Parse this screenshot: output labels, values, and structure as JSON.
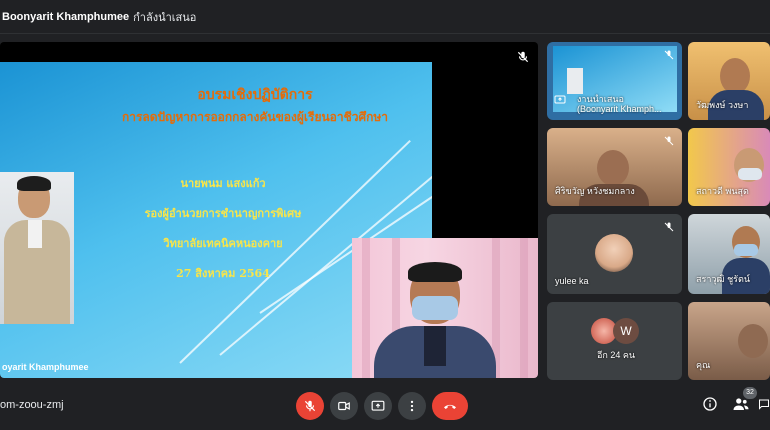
{
  "top_banner": {
    "presenter": "Boonyarit Khamphumee",
    "status": "กำลังนำเสนอ"
  },
  "slide": {
    "title_line1": "อบรมเชิงปฏิบัติการ",
    "title_line2": "การลดปัญหาการออกกลางคันของผู้เรียนอาชีวศึกษา",
    "speaker_name": "นายพนม แสงแก้ว",
    "speaker_role": "รองผู้อำนวยการชำนาญการพิเศษ",
    "institution": "วิทยาลัยเทคนิคหนองคาย",
    "date": "27 สิงหาคม 2564"
  },
  "stage": {
    "speaker_label": "oyarit Khamphumee"
  },
  "tiles": [
    {
      "name": "งานนำเสนอ\n(Boonyarit Khamph...",
      "muted": true
    },
    {
      "name": "วัฒพงษ์ วงษา",
      "muted": false
    },
    {
      "name": "ศิริขวัญ หวังชมกลาง",
      "muted": true
    },
    {
      "name": "สถาวดี พนสุด",
      "muted": false
    },
    {
      "name": "yulee ka",
      "muted": true
    },
    {
      "name": "สราวุฒิ ชูรัตน์",
      "muted": false
    },
    {
      "name": "อีก 24 คน",
      "muted": false,
      "avatar_letter": "W"
    },
    {
      "name": "คุณ",
      "muted": false
    }
  ],
  "bottom_bar": {
    "meeting_code": "om-zoou-zmj",
    "participant_count": "32"
  },
  "colors": {
    "background": "#202124",
    "tile": "#3c4043",
    "danger": "#ea4335",
    "slide_title": "#e46c0a",
    "slide_text": "#f8e54a"
  },
  "icons": {
    "mic": "mic-off-icon",
    "camera": "camera-icon",
    "present": "present-screen-icon",
    "more": "more-vert-icon",
    "hangup": "call-end-icon",
    "info": "info-icon",
    "people": "people-icon",
    "chat": "chat-icon"
  }
}
